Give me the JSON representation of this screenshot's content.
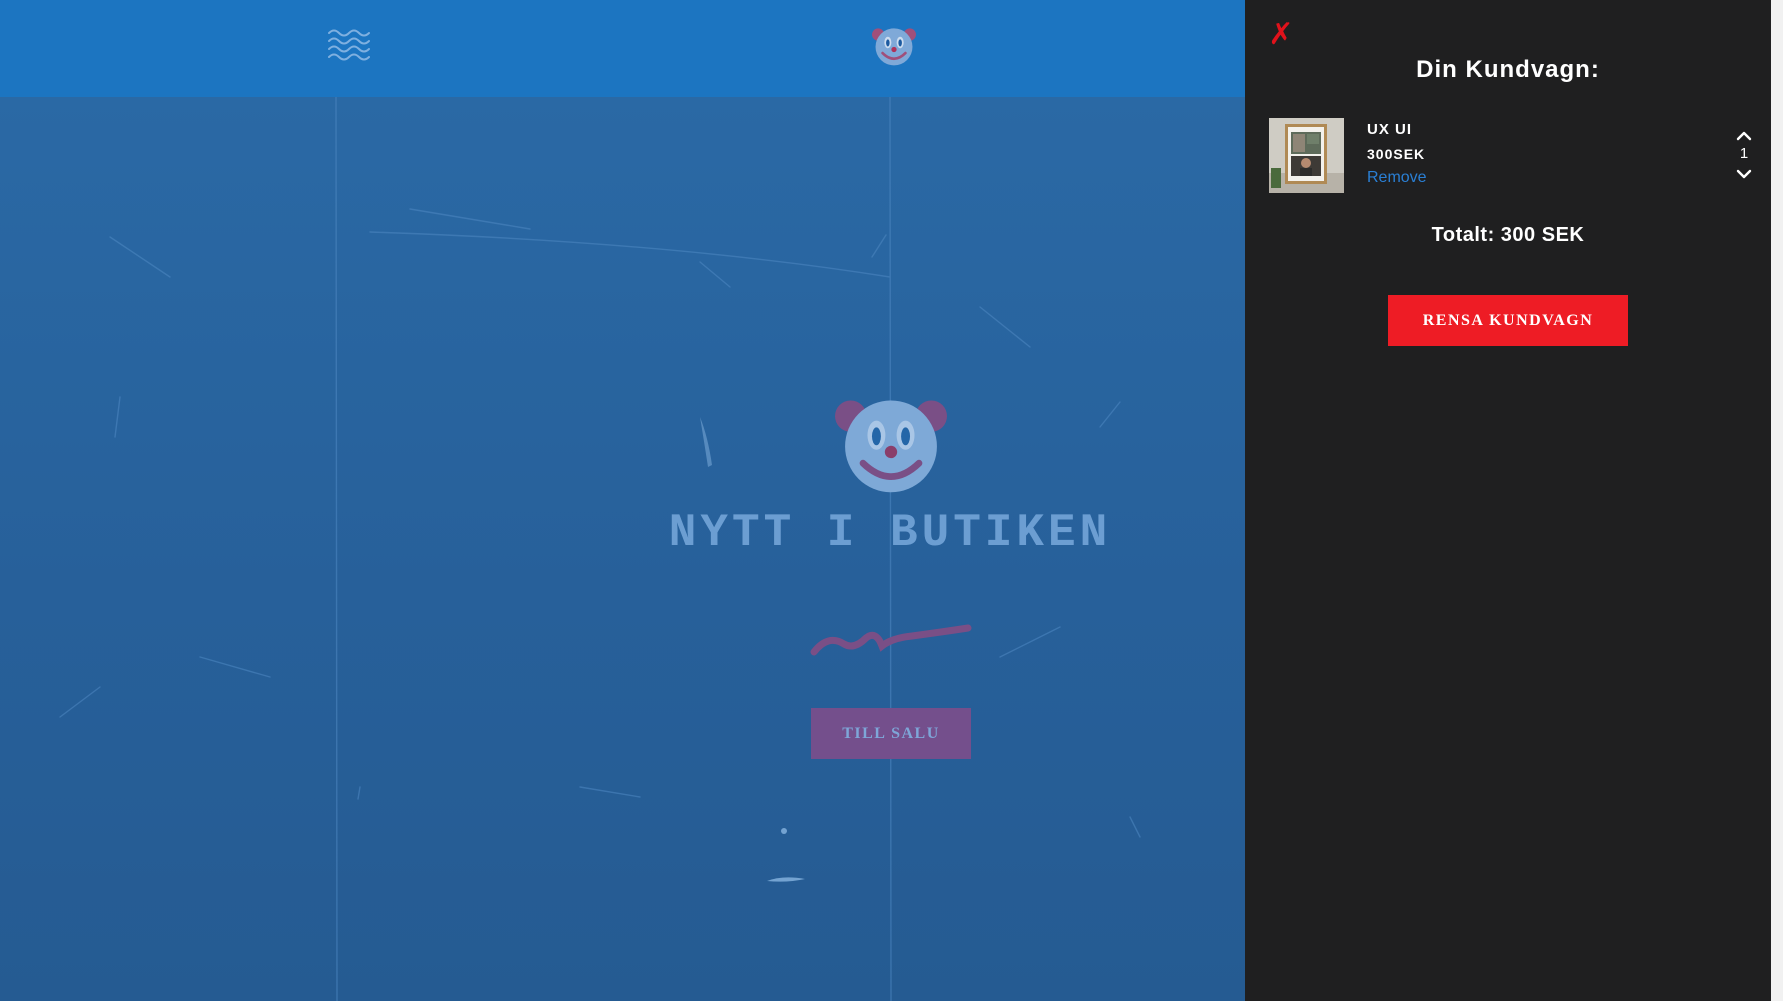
{
  "colors": {
    "topbar": "#1c75c1",
    "hero_background": "#27609a",
    "cart_background": "#1f1f20",
    "accent_red": "#ee1c25",
    "close_red": "#e0121b",
    "link_blue": "#2a7fd4",
    "sale_button": "#744f8c"
  },
  "header": {
    "menu_icon": "waves-menu-icon",
    "logo_icon": "clown-face-icon"
  },
  "hero": {
    "logo_icon": "clown-face-icon",
    "title": "NYTT I BUTIKEN",
    "decoration": "brush-squiggle",
    "cta_label": "TILL SALU"
  },
  "cart": {
    "close_label": "✗",
    "title": "Din Kundvagn:",
    "items": [
      {
        "name": "UX UI",
        "price": "300SEK",
        "remove_label": "Remove",
        "quantity": "1",
        "thumbnail": "framed-photo-thumbnail"
      }
    ],
    "total_label": "Totalt: 300 SEK",
    "clear_label": "RENSA KUNDVAGN"
  }
}
